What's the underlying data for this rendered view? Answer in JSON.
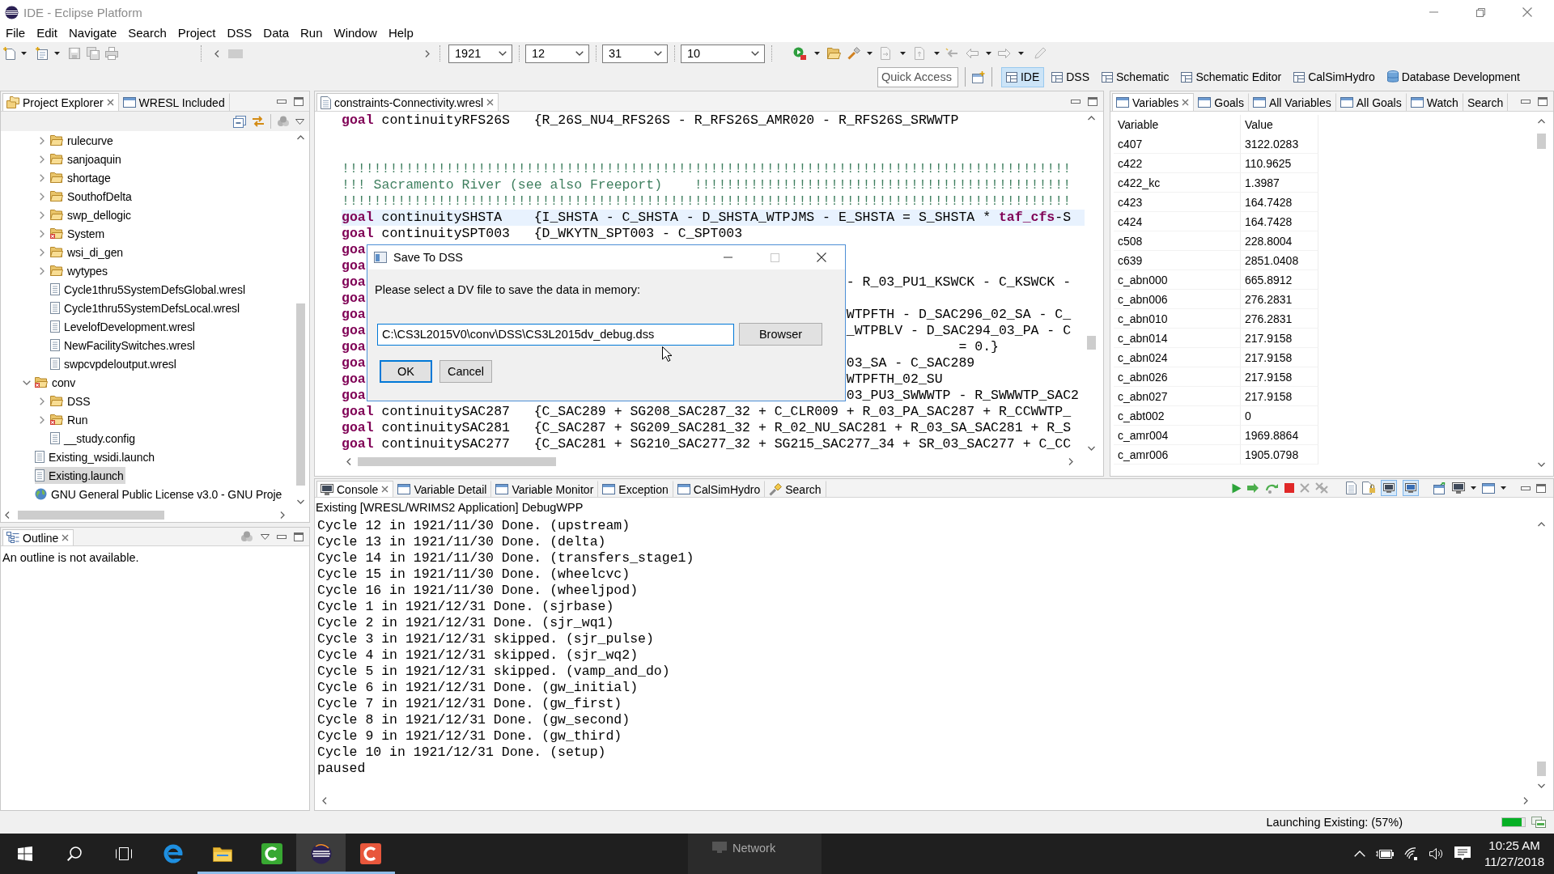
{
  "window": {
    "title": "IDE - Eclipse Platform",
    "active": false
  },
  "menu": [
    "File",
    "Edit",
    "Navigate",
    "Search",
    "Project",
    "DSS",
    "Data",
    "Run",
    "Window",
    "Help"
  ],
  "toolbar": {
    "combos": [
      {
        "value": "1921"
      },
      {
        "value": "12"
      },
      {
        "value": "31"
      },
      {
        "value": "10"
      }
    ],
    "quick_access": {
      "placeholder": "Quick Access"
    },
    "perspectives": [
      {
        "label": "IDE",
        "kind": "layout",
        "selected": true
      },
      {
        "label": "DSS",
        "kind": "layout",
        "selected": false
      },
      {
        "label": "Schematic",
        "kind": "layout",
        "selected": false
      },
      {
        "label": "Schematic Editor",
        "kind": "layout",
        "selected": false
      },
      {
        "label": "CalSimHydro",
        "kind": "layout",
        "selected": false
      },
      {
        "label": "Database Development",
        "kind": "database",
        "selected": false
      }
    ]
  },
  "project_explorer": {
    "tabs": [
      {
        "label": "Project Explorer",
        "kind": "explorer",
        "selected": true
      },
      {
        "label": "WRESL Included",
        "kind": "view",
        "selected": false
      }
    ],
    "tree": [
      {
        "children": [
          {
            "label": "rulecurve",
            "kind": "folder",
            "error": false,
            "expanded": false,
            "selected": false
          },
          {
            "label": "sanjoaquin",
            "kind": "folder",
            "error": false,
            "expanded": false,
            "selected": false
          },
          {
            "label": "shortage",
            "kind": "folder",
            "error": false,
            "expanded": false,
            "selected": false
          },
          {
            "label": "SouthofDelta",
            "kind": "folder",
            "error": false,
            "expanded": false,
            "selected": false
          },
          {
            "label": "swp_dellogic",
            "kind": "folder",
            "error": false,
            "expanded": false,
            "selected": false
          },
          {
            "label": "System",
            "kind": "folder",
            "error": true,
            "expanded": false,
            "selected": false
          },
          {
            "label": "wsi_di_gen",
            "kind": "folder",
            "error": false,
            "expanded": false,
            "selected": false
          },
          {
            "label": "wytypes",
            "kind": "folder",
            "error": false,
            "expanded": false,
            "selected": false
          },
          {
            "label": "Cycle1thru5SystemDefsGlobal.wresl",
            "kind": "file",
            "selected": false
          },
          {
            "label": "Cycle1thru5SystemDefsLocal.wresl",
            "kind": "file",
            "selected": false
          },
          {
            "label": "LevelofDevelopment.wresl",
            "kind": "file",
            "selected": false
          },
          {
            "label": "NewFacilitySwitches.wresl",
            "kind": "file",
            "selected": false
          },
          {
            "label": "swpcvpdeloutput.wresl",
            "kind": "file",
            "selected": false
          }
        ]
      },
      {
        "label": "conv",
        "kind": "folder",
        "error": true,
        "expanded": true,
        "selected": false,
        "children": [
          {
            "label": "DSS",
            "kind": "folder",
            "error": false,
            "expanded": false,
            "selected": false
          },
          {
            "label": "Run",
            "kind": "folder",
            "error": true,
            "expanded": false,
            "selected": false
          },
          {
            "label": "__study.config",
            "kind": "file",
            "selected": false
          }
        ]
      },
      {
        "label": "Existing_wsidi.launch",
        "kind": "file",
        "selected": false
      },
      {
        "label": "Existing.launch",
        "kind": "file",
        "selected": true
      },
      {
        "label": "GNU General Public License v3.0 - GNU Proje",
        "kind": "link",
        "selected": false
      }
    ]
  },
  "outline": {
    "tabs": [
      {
        "label": "Outline",
        "kind": "outline",
        "selected": true
      }
    ],
    "message": "An outline is not available."
  },
  "editor": {
    "tabs": [
      {
        "label": "constraints-Connectivity.wresl",
        "kind": "editor",
        "selected": true
      }
    ],
    "lines": [
      {
        "kind": "code",
        "text": "**goal** continuityRFS26S   {R_26S_NU4_RFS26S - R_RFS26S_AMR020 - R_RFS26S_SRWWTP",
        "current": false
      },
      {
        "kind": "blank",
        "current": false
      },
      {
        "kind": "blank",
        "current": false
      },
      {
        "kind": "comment",
        "text": "!!!!!!!!!!!!!!!!!!!!!!!!!!!!!!!!!!!!!!!!!!!!!!!!!!!!!!!!!!!!!!!!!!!!!!!!!!!!!!!!!!!!!!!!!!!",
        "current": false
      },
      {
        "kind": "comment",
        "text": "!!! Sacramento River (see also Freeport)    !!!!!!!!!!!!!!!!!!!!!!!!!!!!!!!!!!!!!!!!!!!!!!!",
        "current": false
      },
      {
        "kind": "comment",
        "text": "!!!!!!!!!!!!!!!!!!!!!!!!!!!!!!!!!!!!!!!!!!!!!!!!!!!!!!!!!!!!!!!!!!!!!!!!!!!!!!!!!!!!!!!!!!!",
        "current": false
      },
      {
        "kind": "code",
        "text": "**goal** continuitySHSTA    {I_SHSTA - C_SHSTA - D_SHSTA_WTPJMS - E_SHSTA = S_SHSTA * **taf_cfs**-S",
        "current": true
      },
      {
        "kind": "code",
        "text": "**goal** continuitySPT003   {D_WKYTN_SPT003 - C_SPT003",
        "current": false
      },
      {
        "kind": "covered",
        "start": "goa",
        "current": false
      },
      {
        "kind": "covered",
        "start": "goa",
        "current": false
      },
      {
        "kind": "covered",
        "start": "goa",
        "end": "- R_03_PU1_KSWCK - C_KSWCK -",
        "current": false
      },
      {
        "kind": "covered",
        "start": "goa",
        "current": false
      },
      {
        "kind": "covered",
        "start": "goa",
        "end": "WTPFTH - D_SAC296_02_SA - C_",
        "current": false
      },
      {
        "kind": "covered",
        "start": "goa",
        "end": "_WTPBLV - D_SAC294_03_PA - C",
        "current": false
      },
      {
        "kind": "wrapped",
        "start": "goa",
        "end": "= 0.}",
        "current": false
      },
      {
        "kind": "covered",
        "start": "goa",
        "end": "03_SA - C_SAC289",
        "current": false
      },
      {
        "kind": "covered",
        "start": "goa",
        "end": "WTPFTH_02_SU",
        "current": false
      },
      {
        "kind": "covered",
        "start": "goa",
        "end": "03_PU3_SWWWTP - R_SWWWTP_SAC2",
        "current": false
      },
      {
        "kind": "code",
        "text": "**goal** continuitySAC287   {C_SAC289 + SG208_SAC287_32 + C_CLR009 + R_03_PA_SAC287 + R_CCWWTP_",
        "current": false
      },
      {
        "kind": "code",
        "text": "**goal** continuitySAC281   {C_SAC287 + SG209_SAC281_32 + R_02_NU_SAC281 + R_03_SA_SAC281 + R_S",
        "current": false
      },
      {
        "kind": "code",
        "text": "**goal** continuitySAC277   {C_SAC281 + SG210_SAC277_32 + SG215_SAC277_34 + SR_03_SAC277 + C_CC",
        "current": false
      }
    ]
  },
  "variables": {
    "tabs": [
      {
        "label": "Variables",
        "kind": "view",
        "selected": true
      },
      {
        "label": "Goals",
        "kind": "view",
        "selected": false
      },
      {
        "label": "All Variables",
        "kind": "view",
        "selected": false
      },
      {
        "label": "All Goals",
        "kind": "view",
        "selected": false
      },
      {
        "label": "Watch",
        "kind": "view",
        "selected": false
      },
      {
        "label": "Search",
        "kind": "plain",
        "selected": false
      }
    ],
    "columns": [
      "Variable",
      "Value"
    ],
    "rows": [
      {
        "variable": "c407",
        "value": "3122.0283"
      },
      {
        "variable": "c422",
        "value": "110.9625"
      },
      {
        "variable": "c422_kc",
        "value": "1.3987"
      },
      {
        "variable": "c423",
        "value": "164.7428"
      },
      {
        "variable": "c424",
        "value": "164.7428"
      },
      {
        "variable": "c508",
        "value": "228.8004"
      },
      {
        "variable": "c639",
        "value": "2851.0408"
      },
      {
        "variable": "c_abn000",
        "value": "665.8912"
      },
      {
        "variable": "c_abn006",
        "value": "276.2831"
      },
      {
        "variable": "c_abn010",
        "value": "276.2831"
      },
      {
        "variable": "c_abn014",
        "value": "217.9158"
      },
      {
        "variable": "c_abn024",
        "value": "217.9158"
      },
      {
        "variable": "c_abn026",
        "value": "217.9158"
      },
      {
        "variable": "c_abn027",
        "value": "217.9158"
      },
      {
        "variable": "c_abt002",
        "value": "0"
      },
      {
        "variable": "c_amr004",
        "value": "1969.8864"
      },
      {
        "variable": "c_amr006",
        "value": "1905.0798"
      }
    ]
  },
  "console": {
    "tabs": [
      {
        "label": "Console",
        "kind": "console",
        "selected": true
      },
      {
        "label": "Variable Detail",
        "kind": "view",
        "selected": false
      },
      {
        "label": "Variable Monitor",
        "kind": "view",
        "selected": false
      },
      {
        "label": "Exception",
        "kind": "view",
        "selected": false
      },
      {
        "label": "CalSimHydro",
        "kind": "view",
        "selected": false
      },
      {
        "label": "Search",
        "kind": "search",
        "selected": false
      }
    ],
    "description": "Existing [WRESL/WRIMS2 Application] DebugWPP",
    "lines": [
      "Cycle 12 in 1921/11/30 Done. (upstream)",
      "Cycle 13 in 1921/11/30 Done. (delta)",
      "Cycle 14 in 1921/11/30 Done. (transfers_stage1)",
      "Cycle 15 in 1921/11/30 Done. (wheelcvc)",
      "Cycle 16 in 1921/11/30 Done. (wheeljpod)",
      "Cycle 1 in 1921/12/31 Done. (sjrbase)",
      "Cycle 2 in 1921/12/31 Done. (sjr_wq1)",
      "Cycle 3 in 1921/12/31 skipped. (sjr_pulse)",
      "Cycle 4 in 1921/12/31 skipped. (sjr_wq2)",
      "Cycle 5 in 1921/12/31 skipped. (vamp_and_do)",
      "Cycle 6 in 1921/12/31 Done. (gw_initial)",
      "Cycle 7 in 1921/12/31 Done. (gw_first)",
      "Cycle 8 in 1921/12/31 Done. (gw_second)",
      "Cycle 9 in 1921/12/31 Done. (gw_third)",
      "Cycle 10 in 1921/12/31 Done. (setup)",
      "paused"
    ]
  },
  "dialog": {
    "title": "Save To DSS",
    "message": "Please select a DV file to save the data in memory:",
    "path": "C:\\CS3L2015V0\\conv\\DSS\\CS3L2015dv_debug.dss",
    "browse_button": "Browser",
    "buttons": [
      {
        "label": "OK",
        "default": true
      },
      {
        "label": "Cancel",
        "default": false
      }
    ]
  },
  "status_bar": {
    "text": "Launching Existing: (57%)",
    "level": 0.85
  },
  "taskbar": {
    "apps": [
      {
        "kind": "browser",
        "running": false,
        "selected": false
      },
      {
        "kind": "files",
        "running": true,
        "selected": false
      },
      {
        "kind": "recorder",
        "running": true,
        "selected": false
      },
      {
        "kind": "ide",
        "running": true,
        "selected": true
      },
      {
        "kind": "capture",
        "running": true,
        "selected": false
      }
    ],
    "tooltip": "Network",
    "time": "10:25 AM",
    "date": "11/27/2018"
  }
}
